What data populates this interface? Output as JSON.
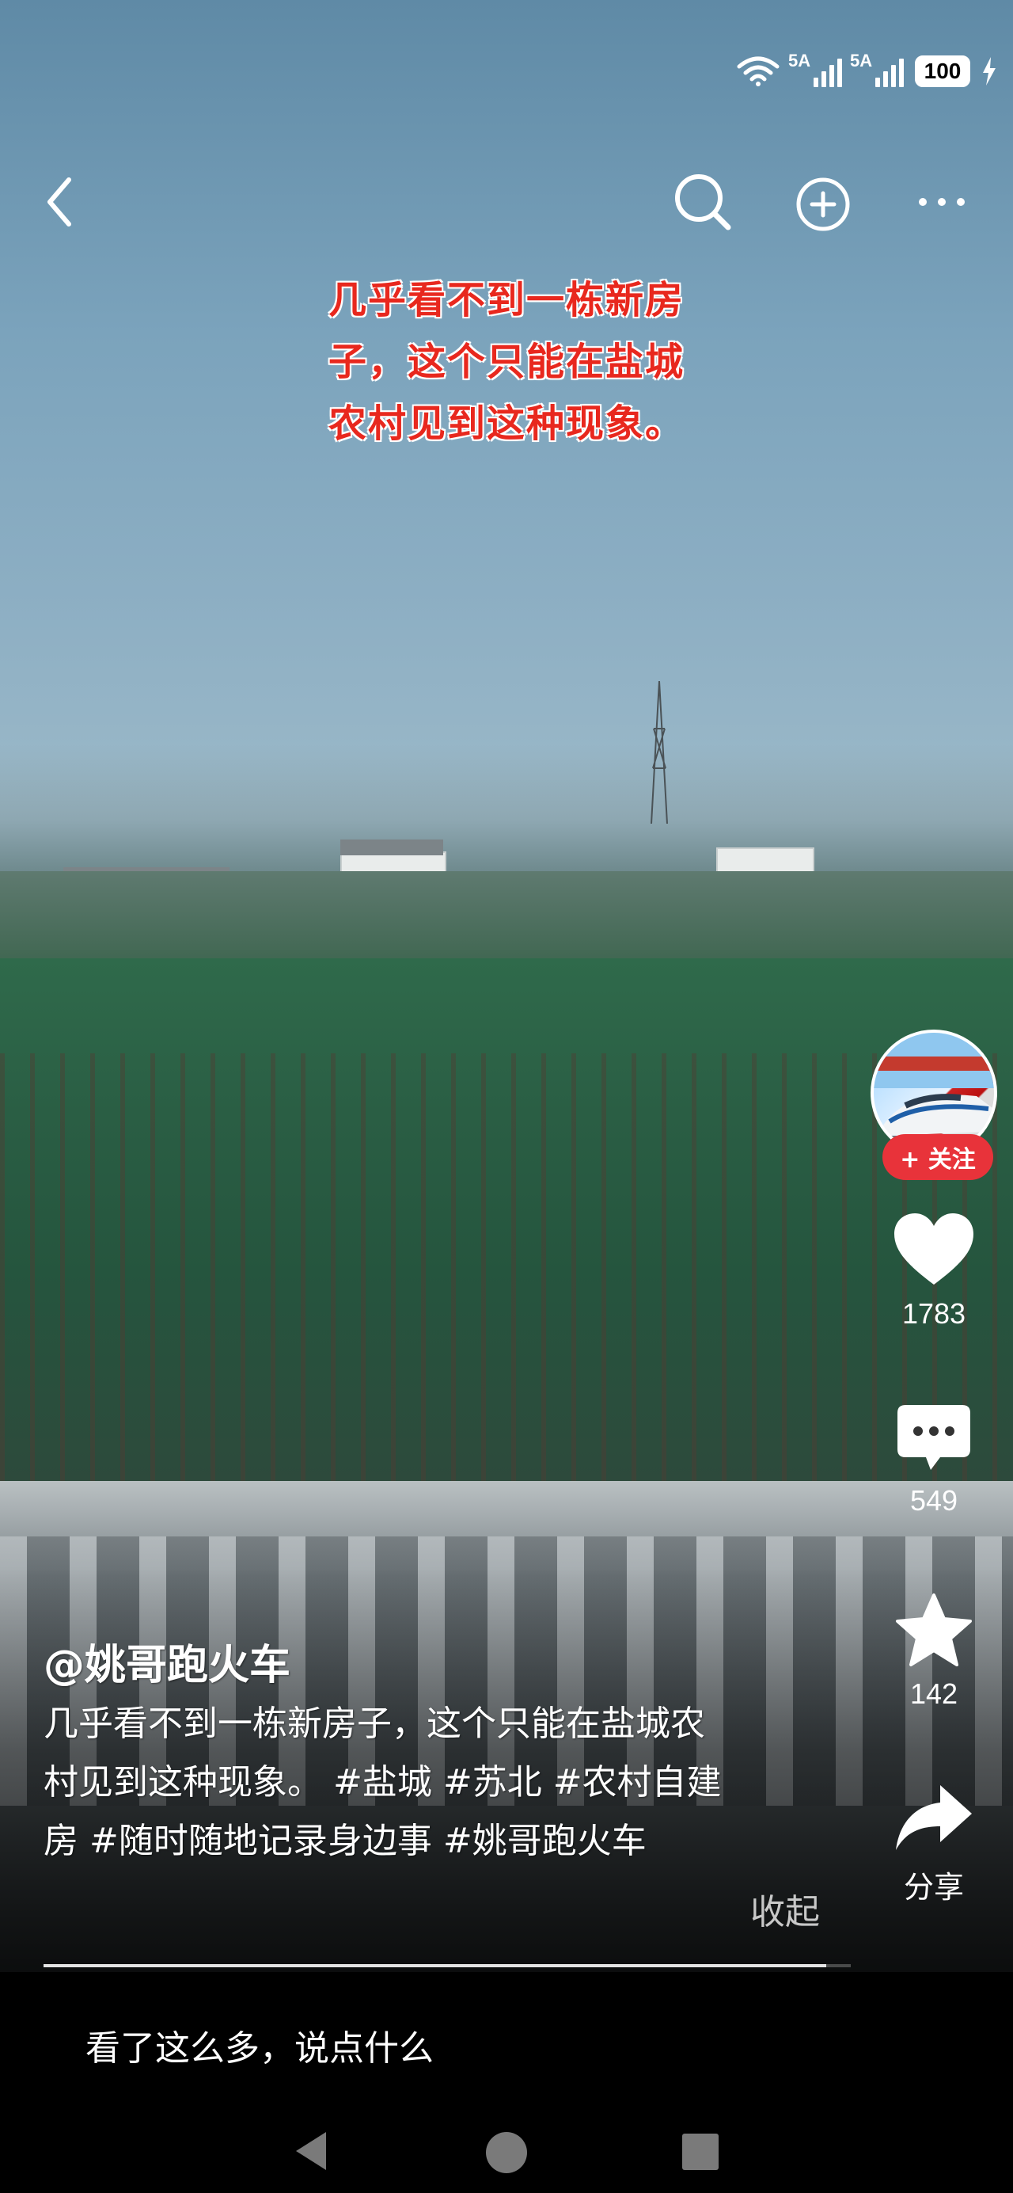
{
  "status_bar": {
    "sim1_label": "5A",
    "sim2_label": "5A",
    "battery": "100"
  },
  "top_nav": {
    "back_icon": "chevron-left-icon",
    "search_icon": "search-icon",
    "add_icon": "plus-circle-icon",
    "more_icon": "more-horizontal-icon"
  },
  "overlay_caption": {
    "line1": "几乎看不到一栋新房",
    "line2": "子，这个只能在盐城",
    "line3": "农村见到这种现象。"
  },
  "right_rail": {
    "follow_label": "+ 关注",
    "like_count": "1783",
    "comment_count": "549",
    "favorite_count": "142",
    "share_label": "分享"
  },
  "post": {
    "author": "@姚哥跑火车",
    "description_line1": "几乎看不到一栋新房子，这个只能在盐城农",
    "description_line2": "村见到这种现象。 #盐城 #苏北 #农村自建",
    "description_line3": "房 #随时随地记录身边事 #姚哥跑火车",
    "collapse_label": "收起",
    "progress": 0.97
  },
  "comment_bar": {
    "placeholder": "看了这么多，说点什么"
  },
  "colors": {
    "caption_red": "#e8281e",
    "follow_red": "#e8333a"
  }
}
